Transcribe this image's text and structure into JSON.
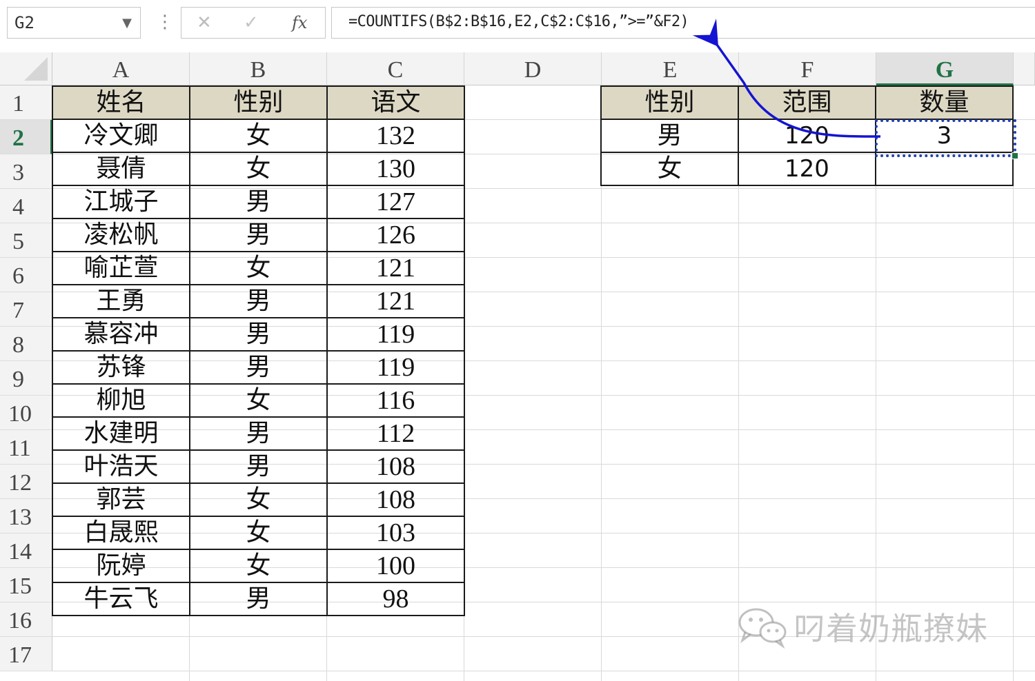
{
  "formula_bar": {
    "name_box": "G2",
    "cancel_glyph": "✕",
    "enter_glyph": "✓",
    "fx_label": "fx",
    "formula": "=COUNTIFS(B$2:B$16,E2,C$2:C$16,”>=”&F2)"
  },
  "columns": [
    "A",
    "B",
    "C",
    "D",
    "E",
    "F",
    "G"
  ],
  "rows": [
    "1",
    "2",
    "3",
    "4",
    "5",
    "6",
    "7",
    "8",
    "9",
    "10",
    "11",
    "12",
    "13",
    "14",
    "15",
    "16",
    "17"
  ],
  "active_cell": {
    "column": "G",
    "row": "2"
  },
  "data_table": {
    "headers": [
      "姓名",
      "性别",
      "语文"
    ],
    "rows": [
      [
        "冷文卿",
        "女",
        "132"
      ],
      [
        "聂倩",
        "女",
        "130"
      ],
      [
        "江城子",
        "男",
        "127"
      ],
      [
        "凌松帆",
        "男",
        "126"
      ],
      [
        "喻芷萱",
        "女",
        "121"
      ],
      [
        "王勇",
        "男",
        "121"
      ],
      [
        "慕容冲",
        "男",
        "119"
      ],
      [
        "苏锋",
        "男",
        "119"
      ],
      [
        "柳旭",
        "女",
        "116"
      ],
      [
        "水建明",
        "男",
        "112"
      ],
      [
        "叶浩天",
        "男",
        "108"
      ],
      [
        "郭芸",
        "女",
        "108"
      ],
      [
        "白晟熙",
        "女",
        "103"
      ],
      [
        "阮婷",
        "女",
        "100"
      ],
      [
        "牛云飞",
        "男",
        "98"
      ]
    ]
  },
  "lookup_table": {
    "headers": [
      "性别",
      "范围",
      "数量"
    ],
    "rows": [
      [
        "男",
        "120",
        "3"
      ],
      [
        "女",
        "120",
        ""
      ]
    ]
  },
  "annotation": {
    "arrow_color": "#1414d2"
  },
  "watermark": {
    "icon": "wechat-icon",
    "text": "叼着奶瓶撩妹"
  },
  "colors": {
    "header_fill": "#ddd8c4",
    "active_green": "#217346"
  }
}
